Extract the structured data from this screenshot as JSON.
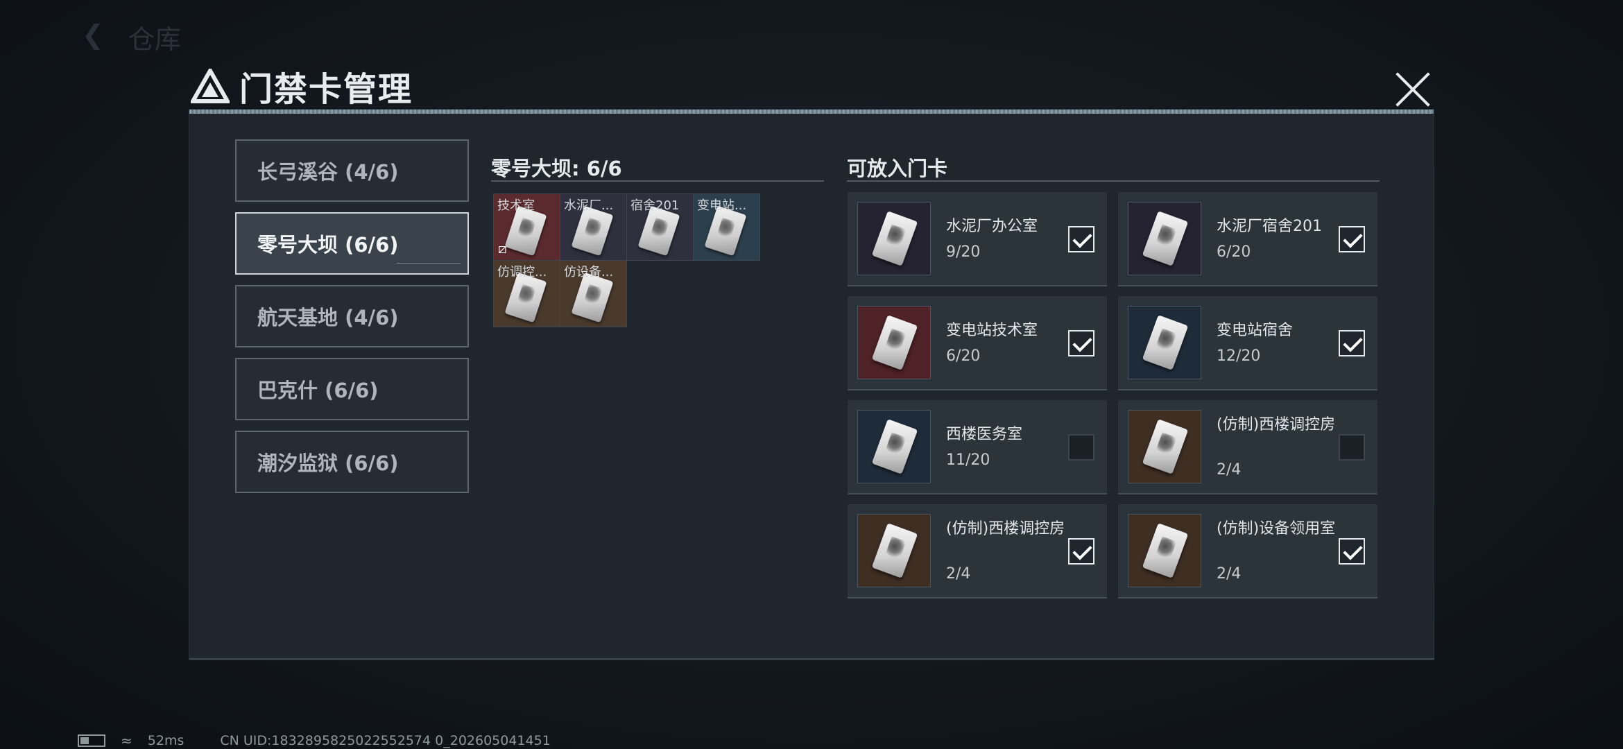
{
  "modal": {
    "title": "门禁卡管理"
  },
  "maps": [
    {
      "label": "长弓溪谷 (4/6)",
      "active": false
    },
    {
      "label": "零号大坝 (6/6)",
      "active": true
    },
    {
      "label": "航天基地 (4/6)",
      "active": false
    },
    {
      "label": "巴克什 (6/6)",
      "active": false
    },
    {
      "label": "潮汐监狱 (6/6)",
      "active": false
    }
  ],
  "slots": {
    "title": "零号大坝: 6/6",
    "items": [
      {
        "label": "技术室",
        "color": "#5a2a2e",
        "broken": true
      },
      {
        "label": "水泥厂...",
        "color": "#2f2f3e",
        "broken": false
      },
      {
        "label": "宿舍201",
        "color": "#2f2f3e",
        "broken": false
      },
      {
        "label": "变电站...",
        "color": "#2c3f4c",
        "broken": false
      },
      {
        "label": "仿调控...",
        "color": "#4a3a2c",
        "broken": false
      },
      {
        "label": "仿设备...",
        "color": "#4a3a2c",
        "broken": false
      }
    ]
  },
  "available": {
    "title": "可放入门卡",
    "cards": [
      {
        "name": "水泥厂办公室",
        "count": "9/20",
        "color": "#252332",
        "checked": true
      },
      {
        "name": "水泥厂宿舍201",
        "count": "6/20",
        "color": "#252332",
        "checked": true
      },
      {
        "name": "变电站技术室",
        "count": "6/20",
        "color": "#4e2226",
        "checked": true
      },
      {
        "name": "变电站宿舍",
        "count": "12/20",
        "color": "#1e2c3a",
        "checked": true
      },
      {
        "name": "西楼医务室",
        "count": "11/20",
        "color": "#1e2c3a",
        "checked": false
      },
      {
        "name": "(仿制)西楼调控房",
        "count": "2/4",
        "color": "#3f2e22",
        "checked": false
      },
      {
        "name": "(仿制)西楼调控房",
        "count": "2/4",
        "color": "#3f2e22",
        "checked": true
      },
      {
        "name": "(仿制)设备领用室",
        "count": "2/4",
        "color": "#3f2e22",
        "checked": true
      }
    ]
  },
  "background": {
    "back_title": "仓库"
  },
  "status_bar": {
    "ping": "52ms",
    "uid": "CN UID:1832895825022552574 0_202605041451"
  }
}
